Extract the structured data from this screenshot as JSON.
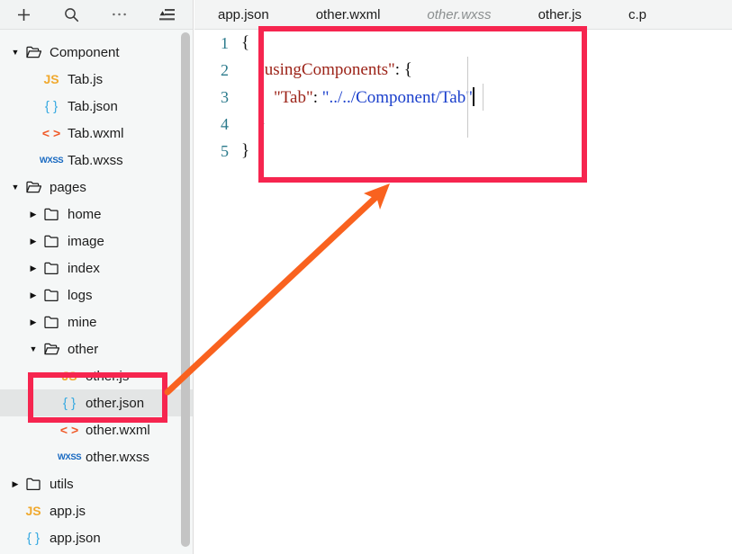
{
  "sidebar": {
    "toolbar": [
      {
        "name": "add-file-icon",
        "label": "+"
      },
      {
        "name": "search-icon",
        "label": "Search"
      },
      {
        "name": "more-options-icon",
        "label": "..."
      },
      {
        "name": "collapse-all-icon",
        "label": "Collapse All"
      }
    ],
    "tree": [
      {
        "label": "Component",
        "kind": "folder-open",
        "depth": 0,
        "arrow": "down",
        "selected": false
      },
      {
        "label": "Tab.js",
        "kind": "js",
        "depth": 1,
        "arrow": "none",
        "selected": false
      },
      {
        "label": "Tab.json",
        "kind": "json",
        "depth": 1,
        "arrow": "none",
        "selected": false
      },
      {
        "label": "Tab.wxml",
        "kind": "wxml",
        "depth": 1,
        "arrow": "none",
        "selected": false
      },
      {
        "label": "Tab.wxss",
        "kind": "wxss",
        "depth": 1,
        "arrow": "none",
        "selected": false
      },
      {
        "label": "pages",
        "kind": "folder-open",
        "depth": 0,
        "arrow": "down",
        "selected": false
      },
      {
        "label": "home",
        "kind": "folder",
        "depth": 1,
        "arrow": "right",
        "selected": false
      },
      {
        "label": "image",
        "kind": "folder",
        "depth": 1,
        "arrow": "right",
        "selected": false
      },
      {
        "label": "index",
        "kind": "folder",
        "depth": 1,
        "arrow": "right",
        "selected": false
      },
      {
        "label": "logs",
        "kind": "folder",
        "depth": 1,
        "arrow": "right",
        "selected": false
      },
      {
        "label": "mine",
        "kind": "folder",
        "depth": 1,
        "arrow": "right",
        "selected": false
      },
      {
        "label": "other",
        "kind": "folder-open",
        "depth": 1,
        "arrow": "down",
        "selected": false
      },
      {
        "label": "other.js",
        "kind": "js",
        "depth": 2,
        "arrow": "none",
        "selected": false
      },
      {
        "label": "other.json",
        "kind": "json",
        "depth": 2,
        "arrow": "none",
        "selected": true
      },
      {
        "label": "other.wxml",
        "kind": "wxml",
        "depth": 2,
        "arrow": "none",
        "selected": false
      },
      {
        "label": "other.wxss",
        "kind": "wxss",
        "depth": 2,
        "arrow": "none",
        "selected": false
      },
      {
        "label": "utils",
        "kind": "folder",
        "depth": 0,
        "arrow": "right",
        "selected": false
      },
      {
        "label": "app.js",
        "kind": "js",
        "depth": 0,
        "arrow": "none",
        "selected": false
      },
      {
        "label": "app.json",
        "kind": "json",
        "depth": 0,
        "arrow": "none",
        "selected": false
      }
    ]
  },
  "editor": {
    "tabs": [
      {
        "label": "app.json",
        "preview": false,
        "active": false
      },
      {
        "label": "other.wxml",
        "preview": false,
        "active": false
      },
      {
        "label": "other.wxss",
        "preview": true,
        "active": false
      },
      {
        "label": "other.js",
        "preview": false,
        "active": false
      },
      {
        "label": "c.p",
        "preview": false,
        "active": false
      }
    ],
    "line_numbers": [
      "1",
      "2",
      "3",
      "4",
      "5"
    ],
    "code": {
      "line1": "{",
      "line2_key": "\"usingComponents\"",
      "line2_tail": ": {",
      "line3_key": "\"Tab\"",
      "line3_sep": ": ",
      "line3_val": "\"../../Component/Tab\"",
      "line4": "}",
      "line5": "}"
    }
  },
  "annotations": {
    "highlight_color": "#f6254f",
    "arrow_color": "#f9621f",
    "code_box": "code-highlight-box",
    "file_box": "file-highlight-box",
    "arrow": "pointer-arrow"
  }
}
